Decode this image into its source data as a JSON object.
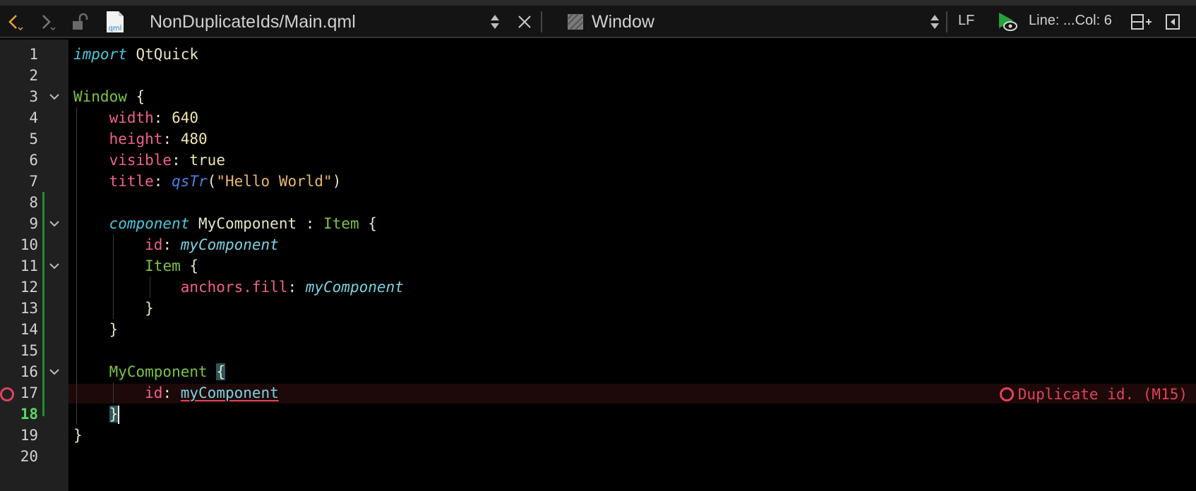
{
  "toolbar": {
    "file_path": "NonDuplicateIds/Main.qml",
    "file_icon_label": "qml",
    "symbol": "Window",
    "line_ending": "LF",
    "cursor_position": "Line: ...Col: 6"
  },
  "editor": {
    "line_numbers": [
      "1",
      "2",
      "3",
      "4",
      "5",
      "6",
      "7",
      "8",
      "9",
      "10",
      "11",
      "12",
      "13",
      "14",
      "15",
      "16",
      "17",
      "18",
      "19",
      "20"
    ],
    "current_line": "18",
    "diagnostic": "Duplicate id. (M15)",
    "tokens": {
      "l1_import": "import",
      "l1_module": "QtQuick",
      "l3_type": "Window",
      "l3_brace": " {",
      "l4_prop": "width",
      "l4_val": "640",
      "l5_prop": "height",
      "l5_val": "480",
      "l6_prop": "visible",
      "l6_val": "true",
      "l7_prop": "title",
      "l7_fn": "qsTr",
      "l7_str": "\"Hello World\"",
      "l9_kw": "component",
      "l9_name": "MyComponent",
      "l9_colon": " : ",
      "l9_base": "Item",
      "l9_brace": " {",
      "l10_prop": "id",
      "l10_val": "myComponent",
      "l11_type": "Item",
      "l11_brace": " {",
      "l12_prop": "anchors.fill",
      "l12_val": "myComponent",
      "l13_brace": "}",
      "l14_brace": "}",
      "l16_type": "MyComponent",
      "l16_brace": "{",
      "l17_prop": "id",
      "l17_val": "myComponent",
      "l18_brace": "}",
      "l19_brace": "}"
    }
  },
  "colors": {
    "keyword": "#49c8dc",
    "type": "#7dc343",
    "property": "#f0628b",
    "string": "#e8b86b",
    "error": "#e0435a",
    "current_line_number": "#58d85c"
  }
}
